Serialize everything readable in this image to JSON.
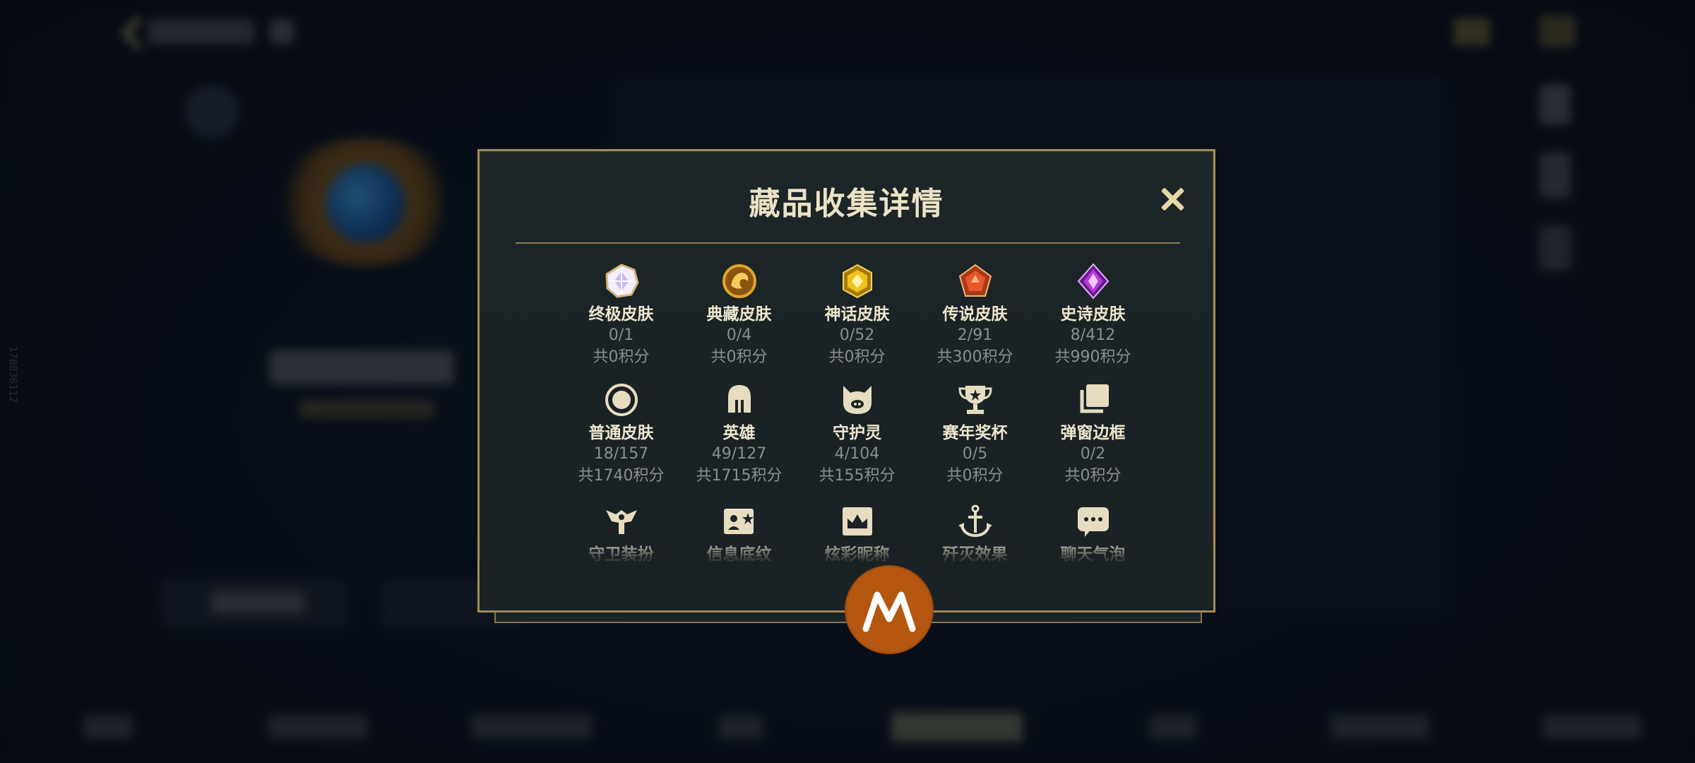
{
  "dialog": {
    "title": "藏品收集详情",
    "close_icon": "close-icon"
  },
  "background": {
    "side_text": "178836112"
  },
  "collection": [
    {
      "label": "终极皮肤",
      "count": "0/1",
      "points": "共0积分",
      "icon": "ultimate-skin-gem-icon",
      "color": "#c9b6f2"
    },
    {
      "label": "典藏皮肤",
      "count": "0/4",
      "points": "共0积分",
      "icon": "collector-skin-dragon-icon",
      "color": "#e0a42a"
    },
    {
      "label": "神话皮肤",
      "count": "0/52",
      "points": "共0积分",
      "icon": "mythic-skin-gem-icon",
      "color": "#f0c21e"
    },
    {
      "label": "传说皮肤",
      "count": "2/91",
      "points": "共300积分",
      "icon": "legend-skin-gem-icon",
      "color": "#e6582a"
    },
    {
      "label": "史诗皮肤",
      "count": "8/412",
      "points": "共990积分",
      "icon": "epic-skin-gem-icon",
      "color": "#b43ad8"
    },
    {
      "label": "普通皮肤",
      "count": "18/157",
      "points": "共1740积分",
      "icon": "normal-skin-ring-icon",
      "color": "#e6dcc0"
    },
    {
      "label": "英雄",
      "count": "49/127",
      "points": "共1715积分",
      "icon": "hero-helmet-icon",
      "color": "#e6dcc0"
    },
    {
      "label": "守护灵",
      "count": "4/104",
      "points": "共155积分",
      "icon": "guardian-spirit-icon",
      "color": "#e6dcc0"
    },
    {
      "label": "赛年奖杯",
      "count": "0/5",
      "points": "共0积分",
      "icon": "trophy-icon",
      "color": "#e6dcc0"
    },
    {
      "label": "弹窗边框",
      "count": "0/2",
      "points": "共0积分",
      "icon": "popup-frame-icon",
      "color": "#e6dcc0"
    },
    {
      "label": "守卫装扮",
      "count": "",
      "points": "",
      "icon": "guard-outfit-icon",
      "color": "#e6dcc0"
    },
    {
      "label": "信息底纹",
      "count": "",
      "points": "",
      "icon": "info-card-icon",
      "color": "#e6dcc0"
    },
    {
      "label": "炫彩昵称",
      "count": "",
      "points": "",
      "icon": "crown-nameplate-icon",
      "color": "#e6dcc0"
    },
    {
      "label": "歼灭效果",
      "count": "",
      "points": "",
      "icon": "anchor-icon",
      "color": "#e6dcc0"
    },
    {
      "label": "聊天气泡",
      "count": "",
      "points": "",
      "icon": "chat-bubble-icon",
      "color": "#e6dcc0"
    }
  ],
  "colors": {
    "modal_border": "#a08959",
    "title_text": "#ece2c4",
    "label_text": "#efe6cd",
    "muted_text": "#8c8e8a",
    "badge": "#b4560f"
  },
  "overlay_badge": {
    "icon": "motorola-m-logo-icon"
  }
}
